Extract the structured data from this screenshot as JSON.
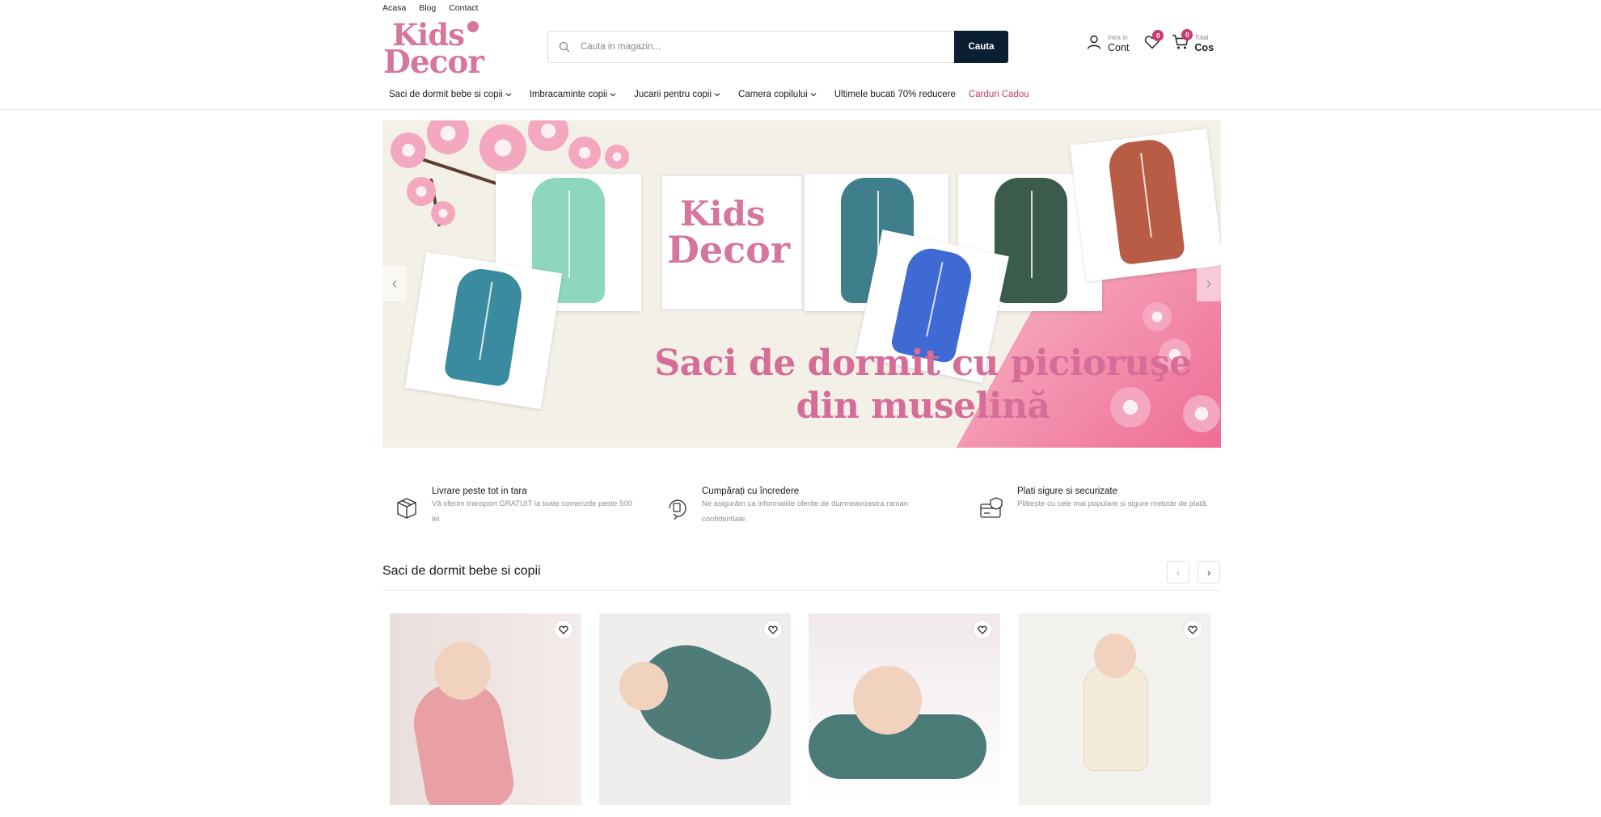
{
  "top_links": [
    "Acasa",
    "Blog",
    "Contact"
  ],
  "logo": {
    "line1": "Kids",
    "line2": "Decor"
  },
  "search": {
    "placeholder": "Cauta in magazin...",
    "button": "Cauta"
  },
  "account": {
    "small": "Intra in",
    "label": "Cont"
  },
  "wishlist": {
    "count": "0"
  },
  "cart": {
    "count": "0",
    "small": "Total",
    "label": "Cos"
  },
  "nav": [
    {
      "label": "Saci de dormit bebe si copii"
    },
    {
      "label": "Imbracaminte copii"
    },
    {
      "label": "Jucarii pentru copii"
    },
    {
      "label": "Camera copilului"
    },
    {
      "label": "Ultimele bucati 70% reducere"
    },
    {
      "label": "Carduri Cadou"
    }
  ],
  "banner": {
    "logo_line1": "Kids",
    "logo_line2": "Decor",
    "title_line1": "Saci de dormit cu picioruşe",
    "title_line2": "din muselină"
  },
  "features": [
    {
      "title": "Livrare peste tot in tara",
      "text": "Vă oferim transport GRATUIT la toate comenzile peste 500 lei",
      "icon": "box-icon"
    },
    {
      "title": "Cumpărați cu încredere",
      "text": "Ne asigurăm ca informatiile oferite de dumneavoastra raman confidentiale.",
      "icon": "shield-return-icon"
    },
    {
      "title": "Plati sigure si securizate",
      "text": "Plătește cu cele mai populare și sigure metode de plată.",
      "icon": "secure-card-icon"
    }
  ],
  "section": {
    "title": "Saci de dormit bebe si copii"
  },
  "colors": {
    "accent": "#c9396f",
    "brand_pink": "#d5779c",
    "button_dark": "#0b1f33"
  }
}
